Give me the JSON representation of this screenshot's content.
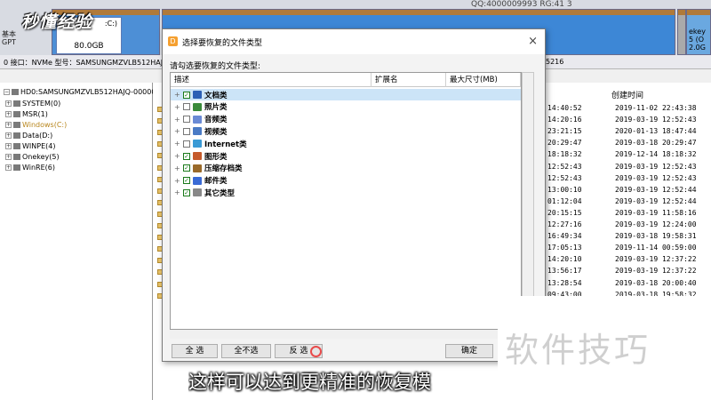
{
  "disk": {
    "left_label_line1": "基本",
    "left_label_line2": "GPT",
    "win_part_lines": [
      ":C:)",
      "NTFS",
      "80.0GB"
    ],
    "data_part_label": "Data(D:)",
    "onekey_lines": [
      "ekey",
      "5 (O",
      "2.0G"
    ],
    "qq_fragment": "QQ:4000009993 RG:41 3",
    "info_left": "0 接口：NVMe  型号：SAMSUNGMZVLB512HAJQ-00000",
    "info_right": "5216"
  },
  "tree": {
    "items": [
      {
        "label": "HD0:SAMSUNGMZVLB512HAJQ-00000(47",
        "style": "root"
      },
      {
        "label": "SYSTEM(0)",
        "style": "normal"
      },
      {
        "label": "MSR(1)",
        "style": "normal"
      },
      {
        "label": "Windows(C:)",
        "style": "orange"
      },
      {
        "label": "Data(D:)",
        "style": "normal"
      },
      {
        "label": "WINPE(4)",
        "style": "normal"
      },
      {
        "label": "Onekey(5)",
        "style": "normal"
      },
      {
        "label": "WinRE(6)",
        "style": "normal"
      }
    ]
  },
  "filelist": {
    "created_header": "创建时间",
    "rows": [
      {
        "mod": "14:40:52",
        "created": "2019-11-02 22:43:38"
      },
      {
        "mod": "14:20:16",
        "created": "2019-03-19 12:52:43"
      },
      {
        "mod": "23:21:15",
        "created": "2020-01-13 18:47:44"
      },
      {
        "mod": "20:29:47",
        "created": "2019-03-18 20:29:47"
      },
      {
        "mod": "18:18:32",
        "created": "2019-12-14 18:18:32"
      },
      {
        "mod": "12:52:43",
        "created": "2019-03-19 12:52:43"
      },
      {
        "mod": "12:52:43",
        "created": "2019-03-19 12:52:43"
      },
      {
        "mod": "13:00:10",
        "created": "2019-03-19 12:52:44"
      },
      {
        "mod": "01:12:04",
        "created": "2019-03-19 12:52:44"
      },
      {
        "mod": "20:15:15",
        "created": "2019-03-19 11:58:16"
      },
      {
        "mod": "12:27:16",
        "created": "2019-03-19 12:24:00"
      },
      {
        "mod": "16:49:34",
        "created": "2019-03-18 19:58:31"
      },
      {
        "mod": "17:05:13",
        "created": "2019-11-14 00:59:00"
      },
      {
        "mod": "14:20:10",
        "created": "2019-03-19 12:37:22"
      },
      {
        "mod": "13:56:17",
        "created": "2019-03-19 12:37:22"
      },
      {
        "mod": "13:28:54",
        "created": "2019-03-18 20:00:40"
      },
      {
        "mod": "09:43:00",
        "created": "2019-03-18 19:58:32"
      }
    ]
  },
  "dialog": {
    "title": "选择要恢复的文件类型",
    "prompt": "请勾选要恢复的文件类型:",
    "columns": [
      "描述",
      "扩展名",
      "最大尺寸(MB)"
    ],
    "types": [
      {
        "label": "文档类",
        "checked": true,
        "icon": "word-icon",
        "color": "#2b5fb5",
        "selected": true
      },
      {
        "label": "照片类",
        "checked": false,
        "icon": "photo-icon",
        "color": "#3a8a3a"
      },
      {
        "label": "音频类",
        "checked": false,
        "icon": "audio-icon",
        "color": "#6a8ad5"
      },
      {
        "label": "视频类",
        "checked": false,
        "icon": "video-icon",
        "color": "#4a7ac5"
      },
      {
        "label": "Internet类",
        "checked": false,
        "icon": "internet-icon",
        "color": "#3a9ad5"
      },
      {
        "label": "图形类",
        "checked": true,
        "icon": "graphics-icon",
        "color": "#c55a2a"
      },
      {
        "label": "压缩存档类",
        "checked": true,
        "icon": "archive-icon",
        "color": "#9a6a2a"
      },
      {
        "label": "邮件类",
        "checked": true,
        "icon": "mail-icon",
        "color": "#3a6ad5"
      },
      {
        "label": "其它类型",
        "checked": true,
        "icon": "other-icon",
        "color": "#888888"
      }
    ],
    "buttons": {
      "select_all": "全 选",
      "select_none": "全不选",
      "invert": "反 选",
      "ok": "确定"
    },
    "close_glyph": "×"
  },
  "overlay": {
    "logo_text": "秒懂经验",
    "subtitle": "这样可以达到更精准的恢复模",
    "watermark": "软件技巧"
  }
}
